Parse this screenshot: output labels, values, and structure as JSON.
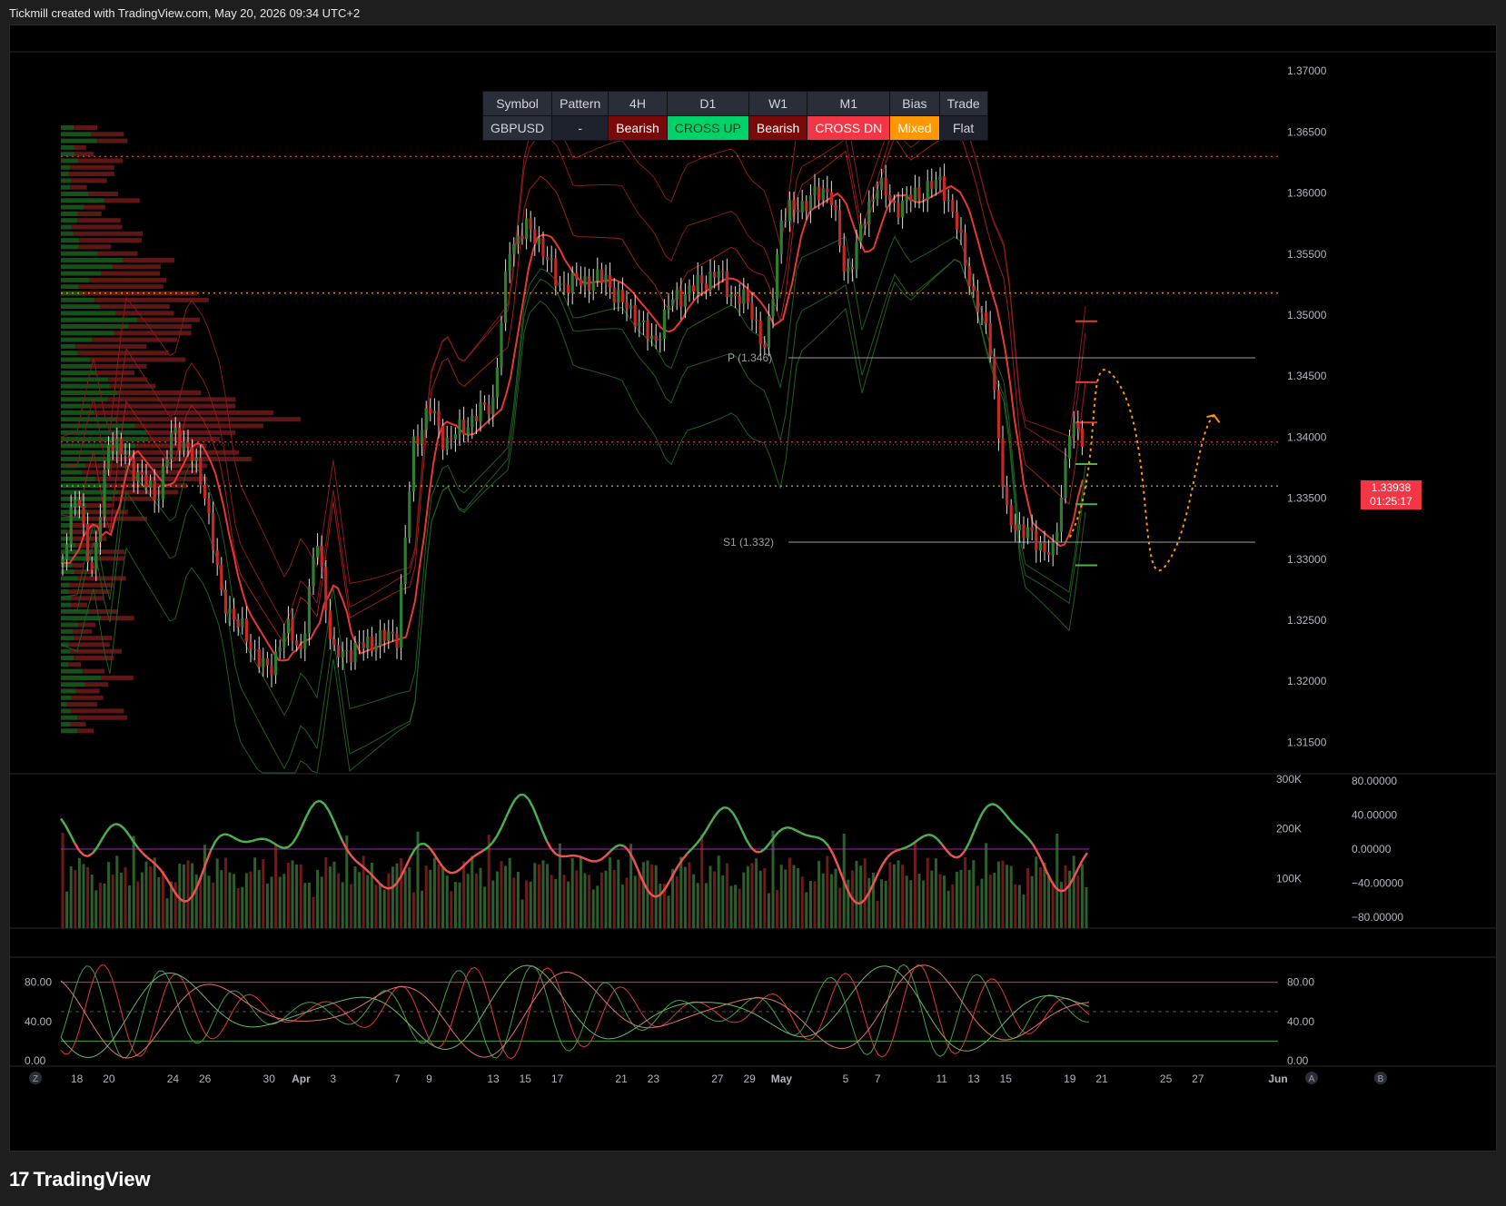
{
  "header": {
    "title": "Tickmill created with TradingView.com, May 20, 2026 09:34 UTC+2"
  },
  "footer": {
    "brand": "TradingView",
    "logo": "17"
  },
  "table": {
    "headers": [
      "Symbol",
      "Pattern",
      "4H",
      "D1",
      "W1",
      "M1",
      "Bias",
      "Trade"
    ],
    "values": [
      "GBPUSD",
      "-",
      "Bearish",
      "CROSS UP",
      "Bearish",
      "CROSS DN",
      "Mixed",
      "Flat"
    ]
  },
  "price_axis": {
    "ticks": [
      "1.37000",
      "1.36500",
      "1.36000",
      "1.35500",
      "1.35000",
      "1.34500",
      "1.34000",
      "1.33500",
      "1.33000",
      "1.32500",
      "1.32000",
      "1.31500"
    ],
    "current_price": "1.33938",
    "countdown": "01:25:17"
  },
  "levels": {
    "pivot_label": "P (1.346)",
    "s1_label": "S1 (1.332)"
  },
  "volume_axis": {
    "ticks": [
      "300K",
      "200K",
      "100K"
    ]
  },
  "osc_axis": {
    "ticks": [
      "80.00000",
      "40.00000",
      "0.00000",
      "−40.00000",
      "−80.00000"
    ]
  },
  "stoch_axis": {
    "left_ticks": [
      "80.00",
      "40.00",
      "0.00"
    ],
    "right_ticks": [
      "80.00",
      "40.00",
      "0.00"
    ]
  },
  "time_axis": {
    "ticks": [
      "18",
      "20",
      "24",
      "26",
      "30",
      "Apr",
      "3",
      "7",
      "9",
      "13",
      "15",
      "17",
      "21",
      "23",
      "27",
      "29",
      "May",
      "5",
      "7",
      "11",
      "13",
      "15",
      "19",
      "21",
      "25",
      "27",
      "Jun"
    ],
    "left_button": "Z",
    "right_buttons": [
      "A",
      "B"
    ]
  },
  "colors": {
    "bull": "#2e7d32",
    "bear": "#c62828",
    "osc_up": "#4caf50",
    "osc_down": "#ef5350",
    "projection": "#ff9800",
    "price_tag": "#f23645"
  },
  "chart_data": {
    "type": "candlestick",
    "symbol": "GBPUSD",
    "ylim": [
      1.3125,
      1.3715
    ],
    "x_range": [
      "Mar 17",
      "Jun 1"
    ],
    "close_path": [
      {
        "x": "Mar 17",
        "y": 1.3297
      },
      {
        "x": "Mar 18",
        "y": 1.3355
      },
      {
        "x": "Mar 19",
        "y": 1.3285
      },
      {
        "x": "Mar 20",
        "y": 1.34
      },
      {
        "x": "Mar 23",
        "y": 1.335
      },
      {
        "x": "Mar 24",
        "y": 1.3405
      },
      {
        "x": "Mar 25",
        "y": 1.339
      },
      {
        "x": "Mar 26",
        "y": 1.3355
      },
      {
        "x": "Mar 27",
        "y": 1.327
      },
      {
        "x": "Mar 30",
        "y": 1.3205
      },
      {
        "x": "Mar 31",
        "y": 1.3245
      },
      {
        "x": "Apr 1",
        "y": 1.3225
      },
      {
        "x": "Apr 2",
        "y": 1.3318
      },
      {
        "x": "Apr 3",
        "y": 1.322
      },
      {
        "x": "Apr 6",
        "y": 1.3235
      },
      {
        "x": "Apr 7",
        "y": 1.3238
      },
      {
        "x": "Apr 8",
        "y": 1.3392
      },
      {
        "x": "Apr 9",
        "y": 1.3425
      },
      {
        "x": "Apr 10",
        "y": 1.3395
      },
      {
        "x": "Apr 13",
        "y": 1.343
      },
      {
        "x": "Apr 14",
        "y": 1.3555
      },
      {
        "x": "Apr 15",
        "y": 1.3572
      },
      {
        "x": "Apr 16",
        "y": 1.3558
      },
      {
        "x": "Apr 17",
        "y": 1.3525
      },
      {
        "x": "Apr 20",
        "y": 1.353
      },
      {
        "x": "Apr 21",
        "y": 1.351
      },
      {
        "x": "Apr 22",
        "y": 1.3498
      },
      {
        "x": "Apr 23",
        "y": 1.3475
      },
      {
        "x": "Apr 24",
        "y": 1.351
      },
      {
        "x": "Apr 27",
        "y": 1.3535
      },
      {
        "x": "Apr 28",
        "y": 1.3515
      },
      {
        "x": "Apr 29",
        "y": 1.351
      },
      {
        "x": "Apr 30",
        "y": 1.3468
      },
      {
        "x": "May 1",
        "y": 1.358
      },
      {
        "x": "May 4",
        "y": 1.3605
      },
      {
        "x": "May 5",
        "y": 1.353
      },
      {
        "x": "May 6",
        "y": 1.357
      },
      {
        "x": "May 7",
        "y": 1.361
      },
      {
        "x": "May 8",
        "y": 1.3588
      },
      {
        "x": "May 11",
        "y": 1.361
      },
      {
        "x": "May 12",
        "y": 1.357
      },
      {
        "x": "May 13",
        "y": 1.3515
      },
      {
        "x": "May 14",
        "y": 1.348
      },
      {
        "x": "May 15",
        "y": 1.3335
      },
      {
        "x": "May 18",
        "y": 1.3303
      },
      {
        "x": "May 19",
        "y": 1.341
      },
      {
        "x": "May 20",
        "y": 1.33938
      }
    ],
    "horizontal_levels": [
      {
        "name": "P",
        "value": 1.346
      },
      {
        "name": "S1",
        "value": 1.332
      }
    ],
    "dotted_levels": [
      1.363,
      1.3518,
      1.3396,
      1.336
    ],
    "projection": [
      {
        "x": "May 19",
        "y": 1.3318
      },
      {
        "x": "May 22",
        "y": 1.3445
      },
      {
        "x": "May 25",
        "y": 1.3295
      },
      {
        "x": "May 28",
        "y": 1.3418
      }
    ],
    "panes": [
      {
        "name": "volume",
        "ylim": [
          0,
          300000
        ]
      },
      {
        "name": "oscillator",
        "ylim": [
          -80,
          80
        ]
      },
      {
        "name": "stochastic",
        "ylim": [
          0,
          100
        ],
        "levels": [
          80,
          20
        ]
      }
    ]
  }
}
